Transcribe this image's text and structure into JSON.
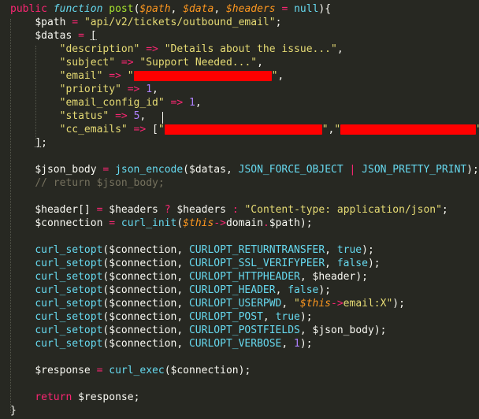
{
  "editor": {
    "background": "#272822",
    "lines": [
      [
        [
          "kw",
          "public"
        ],
        [
          "pl",
          " "
        ],
        [
          "st",
          "function"
        ],
        [
          "pl",
          " "
        ],
        [
          "fn",
          "post"
        ],
        [
          "pl",
          "("
        ],
        [
          "param",
          "$path"
        ],
        [
          "pl",
          ", "
        ],
        [
          "param",
          "$data"
        ],
        [
          "pl",
          ", "
        ],
        [
          "param",
          "$headers"
        ],
        [
          "pl",
          " "
        ],
        [
          "kw",
          "="
        ],
        [
          "pl",
          " "
        ],
        [
          "cst",
          "null"
        ],
        [
          "pl",
          "){"
        ]
      ],
      [
        [
          "pl",
          "    "
        ],
        [
          "var",
          "$path"
        ],
        [
          "pl",
          " "
        ],
        [
          "kw",
          "="
        ],
        [
          "pl",
          " "
        ],
        [
          "str",
          "\"api/v2/tickets/outbound_email\""
        ],
        [
          "pl",
          ";"
        ]
      ],
      [
        [
          "pl",
          "    "
        ],
        [
          "var",
          "$datas"
        ],
        [
          "pl",
          " "
        ],
        [
          "kw",
          "="
        ],
        [
          "pl",
          " "
        ],
        [
          "uline",
          "["
        ]
      ],
      [
        [
          "pl",
          "        "
        ],
        [
          "str",
          "\"description\""
        ],
        [
          "pl",
          " "
        ],
        [
          "kw",
          "=>"
        ],
        [
          "pl",
          " "
        ],
        [
          "str",
          "\"Details about the issue...\""
        ],
        [
          "pl",
          ","
        ]
      ],
      [
        [
          "pl",
          "        "
        ],
        [
          "str",
          "\"subject\""
        ],
        [
          "pl",
          " "
        ],
        [
          "kw",
          "=>"
        ],
        [
          "pl",
          " "
        ],
        [
          "str",
          "\"Support Needed...\""
        ],
        [
          "pl",
          ","
        ]
      ],
      [
        [
          "pl",
          "        "
        ],
        [
          "str",
          "\"email\""
        ],
        [
          "pl",
          " "
        ],
        [
          "kw",
          "=>"
        ],
        [
          "pl",
          " "
        ],
        [
          "str",
          "\""
        ],
        [
          "redact",
          175
        ],
        [
          "str",
          "\""
        ],
        [
          "pl",
          ","
        ]
      ],
      [
        [
          "pl",
          "        "
        ],
        [
          "str",
          "\"priority\""
        ],
        [
          "pl",
          " "
        ],
        [
          "kw",
          "=>"
        ],
        [
          "pl",
          " "
        ],
        [
          "num",
          "1"
        ],
        [
          "pl",
          ","
        ]
      ],
      [
        [
          "pl",
          "        "
        ],
        [
          "str",
          "\"email_config_id\""
        ],
        [
          "pl",
          " "
        ],
        [
          "kw",
          "=>"
        ],
        [
          "pl",
          " "
        ],
        [
          "num",
          "1"
        ],
        [
          "pl",
          ","
        ]
      ],
      [
        [
          "pl",
          "        "
        ],
        [
          "str",
          "\"status\""
        ],
        [
          "pl",
          " "
        ],
        [
          "kw",
          "=>"
        ],
        [
          "pl",
          " "
        ],
        [
          "num",
          "5"
        ],
        [
          "pl",
          ","
        ]
      ],
      [
        [
          "pl",
          "        "
        ],
        [
          "str",
          "\"cc_emails\""
        ],
        [
          "pl",
          " "
        ],
        [
          "kw",
          "=>"
        ],
        [
          "pl",
          " "
        ],
        [
          "pl",
          "["
        ],
        [
          "str",
          "\""
        ],
        [
          "redact",
          200
        ],
        [
          "str",
          "\""
        ],
        [
          "pl",
          ","
        ],
        [
          "str",
          "\""
        ],
        [
          "redact",
          172
        ],
        [
          "str",
          "\""
        ],
        [
          "pl",
          "]"
        ]
      ],
      [
        [
          "pl",
          "    "
        ],
        [
          "uline",
          "]"
        ],
        [
          "pl",
          ";"
        ]
      ],
      [],
      [
        [
          "pl",
          "    "
        ],
        [
          "var",
          "$json_body"
        ],
        [
          "pl",
          " "
        ],
        [
          "kw",
          "="
        ],
        [
          "pl",
          " "
        ],
        [
          "cst",
          "json_encode"
        ],
        [
          "pl",
          "("
        ],
        [
          "var",
          "$datas"
        ],
        [
          "pl",
          ", "
        ],
        [
          "cst",
          "JSON_FORCE_OBJECT"
        ],
        [
          "pl",
          " "
        ],
        [
          "kw",
          "|"
        ],
        [
          "pl",
          " "
        ],
        [
          "cst",
          "JSON_PRETTY_PRINT"
        ],
        [
          "pl",
          ");"
        ]
      ],
      [
        [
          "pl",
          "    "
        ],
        [
          "com",
          "// return $json_body;"
        ]
      ],
      [],
      [
        [
          "pl",
          "    "
        ],
        [
          "var",
          "$header"
        ],
        [
          "pl",
          "[] "
        ],
        [
          "kw",
          "="
        ],
        [
          "pl",
          " "
        ],
        [
          "var",
          "$headers"
        ],
        [
          "pl",
          " "
        ],
        [
          "kw",
          "?"
        ],
        [
          "pl",
          " "
        ],
        [
          "var",
          "$headers"
        ],
        [
          "pl",
          " "
        ],
        [
          "kw",
          ":"
        ],
        [
          "pl",
          " "
        ],
        [
          "str",
          "\"Content-type: application/json\""
        ],
        [
          "pl",
          ";"
        ]
      ],
      [
        [
          "pl",
          "    "
        ],
        [
          "var",
          "$connection"
        ],
        [
          "pl",
          " "
        ],
        [
          "kw",
          "="
        ],
        [
          "pl",
          " "
        ],
        [
          "cst",
          "curl_init"
        ],
        [
          "pl",
          "("
        ],
        [
          "this",
          "$this"
        ],
        [
          "kw",
          "->"
        ],
        [
          "pl",
          "domain"
        ],
        [
          "kw",
          "."
        ],
        [
          "var",
          "$path"
        ],
        [
          "pl",
          ");"
        ]
      ],
      [],
      [
        [
          "pl",
          "    "
        ],
        [
          "cst",
          "curl_setopt"
        ],
        [
          "pl",
          "("
        ],
        [
          "var",
          "$connection"
        ],
        [
          "pl",
          ", "
        ],
        [
          "cst",
          "CURLOPT_RETURNTRANSFER"
        ],
        [
          "pl",
          ", "
        ],
        [
          "cst",
          "true"
        ],
        [
          "pl",
          ");"
        ]
      ],
      [
        [
          "pl",
          "    "
        ],
        [
          "cst",
          "curl_setopt"
        ],
        [
          "pl",
          "("
        ],
        [
          "var",
          "$connection"
        ],
        [
          "pl",
          ", "
        ],
        [
          "cst",
          "CURLOPT_SSL_VERIFYPEER"
        ],
        [
          "pl",
          ", "
        ],
        [
          "cst",
          "false"
        ],
        [
          "pl",
          ");"
        ]
      ],
      [
        [
          "pl",
          "    "
        ],
        [
          "cst",
          "curl_setopt"
        ],
        [
          "pl",
          "("
        ],
        [
          "var",
          "$connection"
        ],
        [
          "pl",
          ", "
        ],
        [
          "cst",
          "CURLOPT_HTTPHEADER"
        ],
        [
          "pl",
          ", "
        ],
        [
          "var",
          "$header"
        ],
        [
          "pl",
          ");"
        ]
      ],
      [
        [
          "pl",
          "    "
        ],
        [
          "cst",
          "curl_setopt"
        ],
        [
          "pl",
          "("
        ],
        [
          "var",
          "$connection"
        ],
        [
          "pl",
          ", "
        ],
        [
          "cst",
          "CURLOPT_HEADER"
        ],
        [
          "pl",
          ", "
        ],
        [
          "cst",
          "false"
        ],
        [
          "pl",
          ");"
        ]
      ],
      [
        [
          "pl",
          "    "
        ],
        [
          "cst",
          "curl_setopt"
        ],
        [
          "pl",
          "("
        ],
        [
          "var",
          "$connection"
        ],
        [
          "pl",
          ", "
        ],
        [
          "cst",
          "CURLOPT_USERPWD"
        ],
        [
          "pl",
          ", "
        ],
        [
          "str",
          "\""
        ],
        [
          "this",
          "$this"
        ],
        [
          "kw",
          "->"
        ],
        [
          "str",
          "email:X\""
        ],
        [
          "pl",
          ");"
        ]
      ],
      [
        [
          "pl",
          "    "
        ],
        [
          "cst",
          "curl_setopt"
        ],
        [
          "pl",
          "("
        ],
        [
          "var",
          "$connection"
        ],
        [
          "pl",
          ", "
        ],
        [
          "cst",
          "CURLOPT_POST"
        ],
        [
          "pl",
          ", "
        ],
        [
          "cst",
          "true"
        ],
        [
          "pl",
          ");"
        ]
      ],
      [
        [
          "pl",
          "    "
        ],
        [
          "cst",
          "curl_setopt"
        ],
        [
          "pl",
          "("
        ],
        [
          "var",
          "$connection"
        ],
        [
          "pl",
          ", "
        ],
        [
          "cst",
          "CURLOPT_POSTFIELDS"
        ],
        [
          "pl",
          ", "
        ],
        [
          "var",
          "$json_body"
        ],
        [
          "pl",
          ");"
        ]
      ],
      [
        [
          "pl",
          "    "
        ],
        [
          "cst",
          "curl_setopt"
        ],
        [
          "pl",
          "("
        ],
        [
          "var",
          "$connection"
        ],
        [
          "pl",
          ", "
        ],
        [
          "cst",
          "CURLOPT_VERBOSE"
        ],
        [
          "pl",
          ", "
        ],
        [
          "num",
          "1"
        ],
        [
          "pl",
          ");"
        ]
      ],
      [],
      [
        [
          "pl",
          "    "
        ],
        [
          "var",
          "$response"
        ],
        [
          "pl",
          " "
        ],
        [
          "kw",
          "="
        ],
        [
          "pl",
          " "
        ],
        [
          "cst",
          "curl_exec"
        ],
        [
          "pl",
          "("
        ],
        [
          "var",
          "$connection"
        ],
        [
          "pl",
          ");"
        ]
      ],
      [],
      [
        [
          "pl",
          "    "
        ],
        [
          "kw",
          "return"
        ],
        [
          "pl",
          " "
        ],
        [
          "var",
          "$response"
        ],
        [
          "pl",
          ";"
        ]
      ],
      [
        [
          "pl",
          "}"
        ]
      ]
    ]
  }
}
